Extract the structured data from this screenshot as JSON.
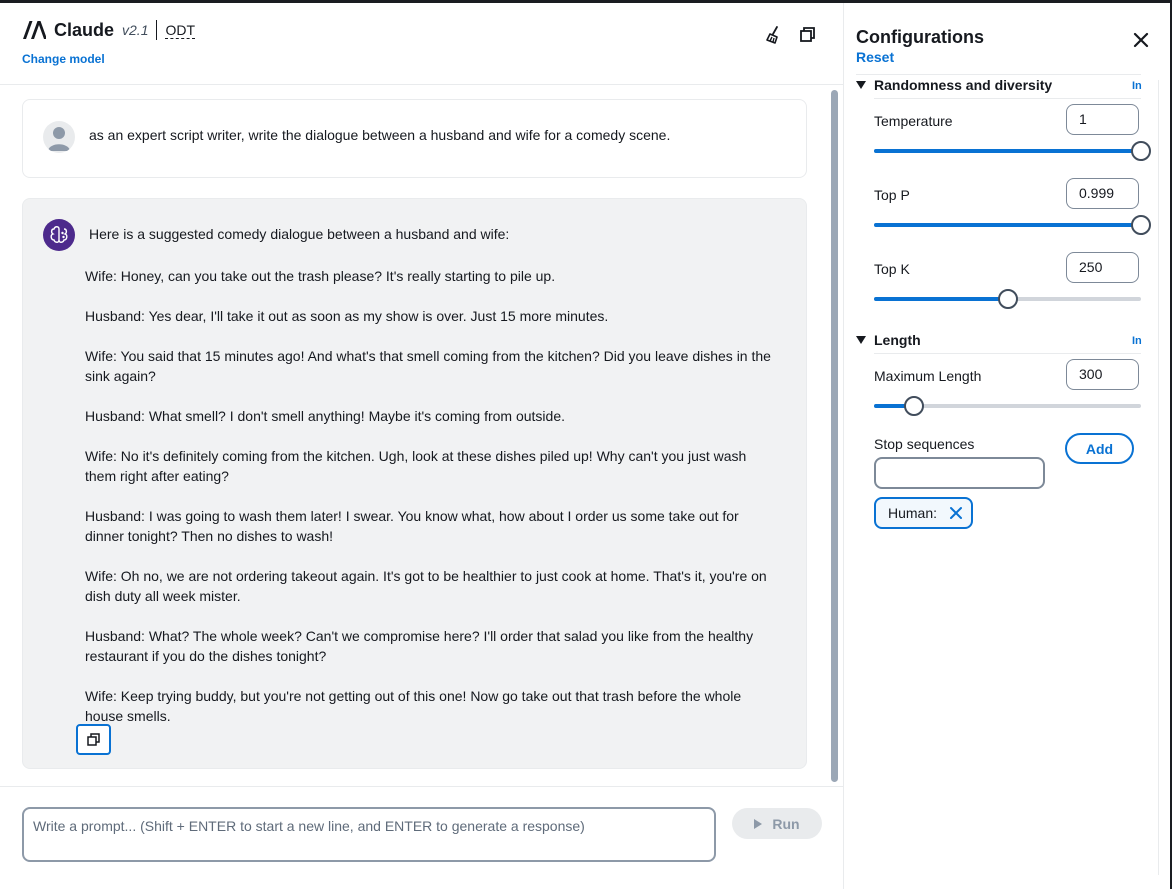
{
  "header": {
    "model_name": "Claude",
    "model_version": "v2.1",
    "mode": "ODT",
    "change_model_label": "Change model"
  },
  "chat": {
    "user_prompt": "as an expert script writer, write the dialogue between a husband and wife for a comedy scene.",
    "response_intro": "Here is a suggested comedy dialogue between a husband and wife:",
    "response_lines": [
      "Wife: Honey, can you take out the trash please? It's really starting to pile up.",
      "Husband: Yes dear, I'll take it out as soon as my show is over. Just 15 more minutes.",
      "Wife: You said that 15 minutes ago! And what's that smell coming from the kitchen? Did you leave dishes in the sink again?",
      "Husband: What smell? I don't smell anything! Maybe it's coming from outside.",
      "Wife: No it's definitely coming from the kitchen. Ugh, look at these dishes piled up! Why can't you just wash them right after eating?",
      "Husband: I was going to wash them later! I swear. You know what, how about I order us some take out for dinner tonight? Then no dishes to wash!",
      "Wife: Oh no, we are not ordering takeout again. It's got to be healthier to just cook at home. That's it, you're on dish duty all week mister.",
      "Husband: What? The whole week? Can't we compromise here? I'll order that salad you like from the healthy restaurant if you do the dishes tonight?",
      "Wife: Keep trying buddy, but you're not getting out of this one! Now go take out that trash before the whole house smells."
    ]
  },
  "composer": {
    "placeholder": "Write a prompt... (Shift + ENTER to start a new line, and ENTER to generate a response)",
    "run_label": "Run"
  },
  "config": {
    "title": "Configurations",
    "reset_label": "Reset",
    "info_label": "In",
    "randomness": {
      "heading": "Randomness and diversity",
      "temperature": {
        "label": "Temperature",
        "value": "1",
        "fraction": 1.0
      },
      "top_p": {
        "label": "Top P",
        "value": "0.999",
        "fraction": 1.0
      },
      "top_k": {
        "label": "Top K",
        "value": "250",
        "fraction": 0.5
      }
    },
    "length": {
      "heading": "Length",
      "max_length": {
        "label": "Maximum Length",
        "value": "300",
        "fraction": 0.15
      },
      "stop_sequences_label": "Stop sequences",
      "add_label": "Add",
      "tokens": [
        "Human:"
      ]
    }
  },
  "colors": {
    "accent": "#0972d3",
    "text": "#16191f",
    "response_bg": "#f1f2f3",
    "bot_avatar": "#4d2a8c"
  }
}
